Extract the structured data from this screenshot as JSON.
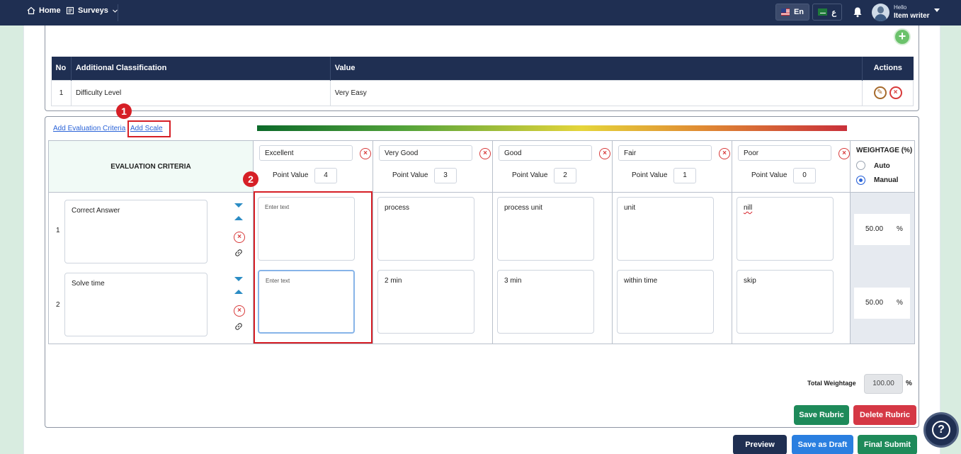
{
  "topbar": {
    "home_label": "Home",
    "surveys_label": "Surveys",
    "lang_en": "En",
    "lang_ar": "ع",
    "user_greeting": "Hello",
    "user_name": "Item writer"
  },
  "classification_table": {
    "headers": [
      "No",
      "Additional Classification",
      "Value",
      "Actions"
    ],
    "rows": [
      {
        "no": "1",
        "classification": "Difficulty Level",
        "value": "Very Easy"
      }
    ]
  },
  "rubric": {
    "add_evaluation_criteria": "Add Evaluation Criteria",
    "add_scale": "Add Scale",
    "criteria_header": "EVALUATION CRITERIA",
    "point_value_label": "Point Value",
    "scales": [
      {
        "name": "Excellent",
        "point_value": "4"
      },
      {
        "name": "Very Good",
        "point_value": "3"
      },
      {
        "name": "Good",
        "point_value": "2"
      },
      {
        "name": "Fair",
        "point_value": "1"
      },
      {
        "name": "Poor",
        "point_value": "0"
      }
    ],
    "weightage": {
      "title": "WEIGHTAGE (%)",
      "auto_label": "Auto",
      "manual_label": "Manual",
      "selected": "Manual"
    },
    "criteria": [
      {
        "no": "1",
        "name": "Correct Answer",
        "descriptions": [
          "Enter text",
          "process",
          "process unit",
          "unit",
          "nill"
        ],
        "weight": "50.00"
      },
      {
        "no": "2",
        "name": "Solve time",
        "descriptions": [
          "Enter text",
          "2 min",
          "3 min",
          "within time",
          "skip"
        ],
        "weight": "50.00"
      }
    ],
    "percent_sign": "%",
    "total_label": "Total Weightage",
    "total_value": "100.00",
    "save_label": "Save Rubric",
    "delete_label": "Delete Rubric"
  },
  "annotations": {
    "badge1": "1",
    "badge2": "2"
  },
  "footer": {
    "preview_label": "Preview",
    "draft_label": "Save as Draft",
    "final_label": "Final Submit"
  },
  "help_label": "?",
  "colors": {
    "navy": "#1f2f52",
    "green": "#1e8a5a",
    "red": "#d53845",
    "blue": "#2a7fe0",
    "highlight_red": "#d61f26"
  }
}
